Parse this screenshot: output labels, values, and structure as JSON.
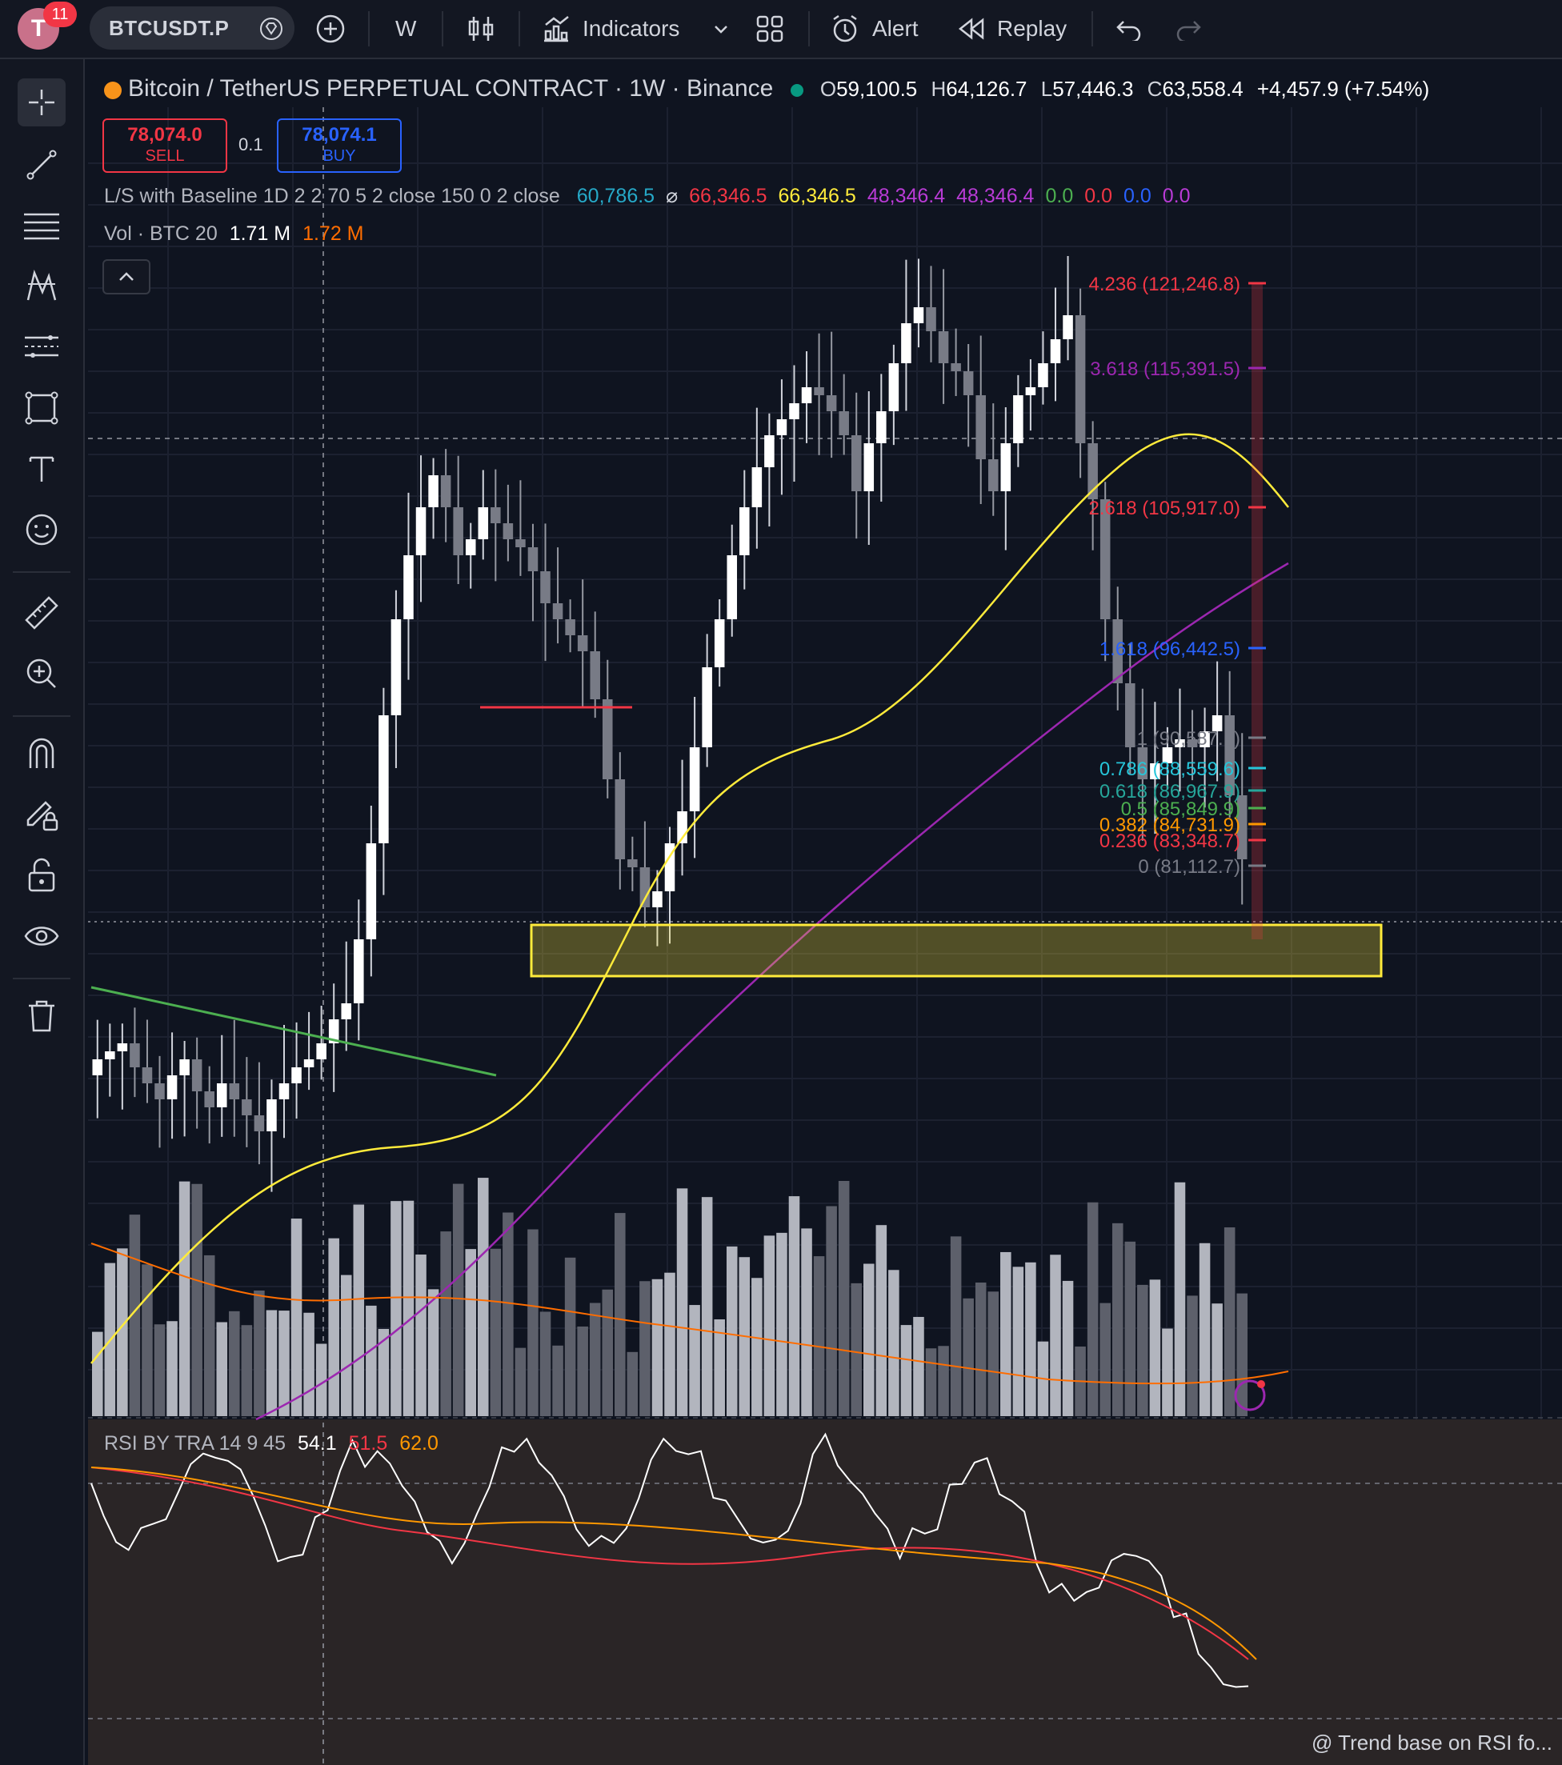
{
  "topbar": {
    "avatar_letter": "T",
    "notification_count": "11",
    "symbol": "BTCUSDT.P",
    "interval": "W",
    "indicators_label": "Indicators",
    "alert_label": "Alert",
    "replay_label": "Replay"
  },
  "legend": {
    "title": "Bitcoin / TetherUS PERPETUAL CONTRACT · 1W · Binance",
    "open_label": "O",
    "open": "59,100.5",
    "high_label": "H",
    "high": "64,126.7",
    "low_label": "L",
    "low": "57,446.3",
    "close_label": "C",
    "close": "63,558.4",
    "change": "+4,457.9 (+7.54%)",
    "sell_price": "78,074.0",
    "sell_label": "SELL",
    "buy_price": "78,074.1",
    "buy_label": "BUY",
    "quantity": "0.1",
    "indicator1_name": "L/S with Baseline 1D 2 2 70 5 2 close 150 0 2 close",
    "indicator1_values": [
      {
        "v": "60,786.5",
        "color": "#26a9c8"
      },
      {
        "v": "⌀",
        "color": "#d1d4dc"
      },
      {
        "v": "66,346.5",
        "color": "#f23645"
      },
      {
        "v": "66,346.5",
        "color": "#ffeb3b"
      },
      {
        "v": "48,346.4",
        "color": "#b93bd6"
      },
      {
        "v": "48,346.4",
        "color": "#b93bd6"
      },
      {
        "v": "0.0",
        "color": "#4caf50"
      },
      {
        "v": "0.0",
        "color": "#f23645"
      },
      {
        "v": "0.0",
        "color": "#2962ff"
      },
      {
        "v": "0.0",
        "color": "#b93bd6"
      }
    ],
    "volume_name": "Vol · BTC 20",
    "volume_value": "1.71 M",
    "volume_ma": "1.72 M"
  },
  "fib_labels": [
    {
      "text": "4.236 (121,246.8)",
      "color": "#f23645"
    },
    {
      "text": "3.618 (115,391.5)",
      "color": "#9c27b0"
    },
    {
      "text": "2.618 (105,917.0)",
      "color": "#f23645"
    },
    {
      "text": "1.618 (96,442.5)",
      "color": "#2962ff"
    },
    {
      "text": "1 (90,587.1)",
      "color": "#787b86"
    },
    {
      "text": "0.786 (88,559.6)",
      "color": "#26c6da"
    },
    {
      "text": "0.618 (86,967.9)",
      "color": "#26a69a"
    },
    {
      "text": "0.5 (85,849.9)",
      "color": "#4caf50"
    },
    {
      "text": "0.382 (84,731.9)",
      "color": "#ff9800"
    },
    {
      "text": "0.236 (83,348.7)",
      "color": "#f23645"
    },
    {
      "text": "0 (81,112.7)",
      "color": "#787b86"
    }
  ],
  "rsi": {
    "name": "RSI BY TRA 14 9 45",
    "value1": "54.1",
    "value2": "51.5",
    "value3": "62.0"
  },
  "footer_note": "@ Trend base on RSI fo...",
  "colors": {
    "bg": "#0f1420",
    "up": "#ffffff",
    "down": "#787b86",
    "ma_yellow": "#ffeb3b",
    "ma_purple": "#9c27b0",
    "zone": "#ffeb3b"
  },
  "icons": [
    "plus-circle-icon",
    "candles-icon",
    "indicators-icon",
    "layout-icon",
    "alert-icon",
    "replay-icon",
    "undo-icon",
    "redo-icon",
    "crosshair-icon",
    "trendline-icon",
    "fib-icon",
    "pattern-icon",
    "forecast-icon",
    "shapes-icon",
    "text-icon",
    "emoji-icon",
    "ruler-icon",
    "zoom-in-icon",
    "magnet-icon",
    "lock-draw-icon",
    "unlock-icon",
    "eye-icon",
    "trash-icon"
  ]
}
